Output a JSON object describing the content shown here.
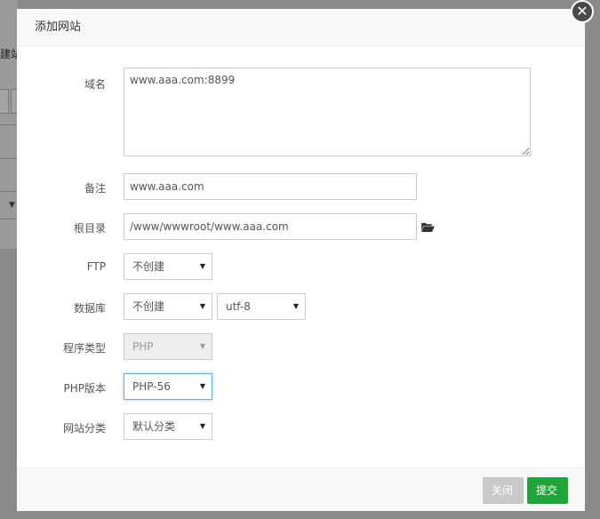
{
  "background": {
    "partial_text": "建站"
  },
  "dialog": {
    "title": "添加网站",
    "close_glyph": "✕"
  },
  "form": {
    "domain_label": "域名",
    "domain_value": "www.aaa.com:8899",
    "remark_label": "备注",
    "remark_value": "www.aaa.com",
    "root_label": "根目录",
    "root_value": "/www/wwwroot/www.aaa.com",
    "ftp_label": "FTP",
    "ftp_selected": "不创建",
    "database_label": "数据库",
    "database_selected": "不创建",
    "charset_selected": "utf-8",
    "program_type_label": "程序类型",
    "program_type_selected": "PHP",
    "php_version_label": "PHP版本",
    "php_version_selected": "PHP-56",
    "category_label": "网站分类",
    "category_selected": "默认分类"
  },
  "footer": {
    "close_label": "关闭",
    "submit_label": "提交"
  },
  "colors": {
    "submit": "#20a53a",
    "close": "#c9c9c9",
    "focus": "#66afe9"
  }
}
